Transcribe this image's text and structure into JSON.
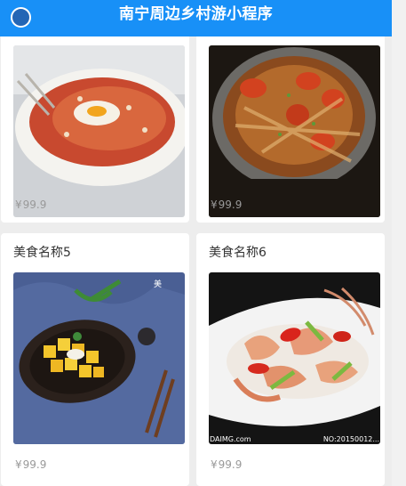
{
  "header": {
    "title": "南宁周边乡村游小程序"
  },
  "products": [
    {
      "name": "",
      "currency": "¥",
      "price": "99.9",
      "image": "pasta-dish-icon"
    },
    {
      "name": "",
      "currency": "¥",
      "price": "99.9",
      "image": "crab-dish-icon"
    },
    {
      "name": "美食名称5",
      "currency": "¥",
      "price": "99.9",
      "image": "mango-dessert-icon"
    },
    {
      "name": "美食名称6",
      "currency": "¥",
      "price": "99.9",
      "image": "crab-pepper-dish-icon"
    }
  ],
  "photo_watermarks": {
    "dish6_left": "DAIMG.com",
    "dish6_right": "NO:20150012..."
  },
  "colors": {
    "header": "#1890f7",
    "background": "#ededed",
    "price": "#999999"
  }
}
